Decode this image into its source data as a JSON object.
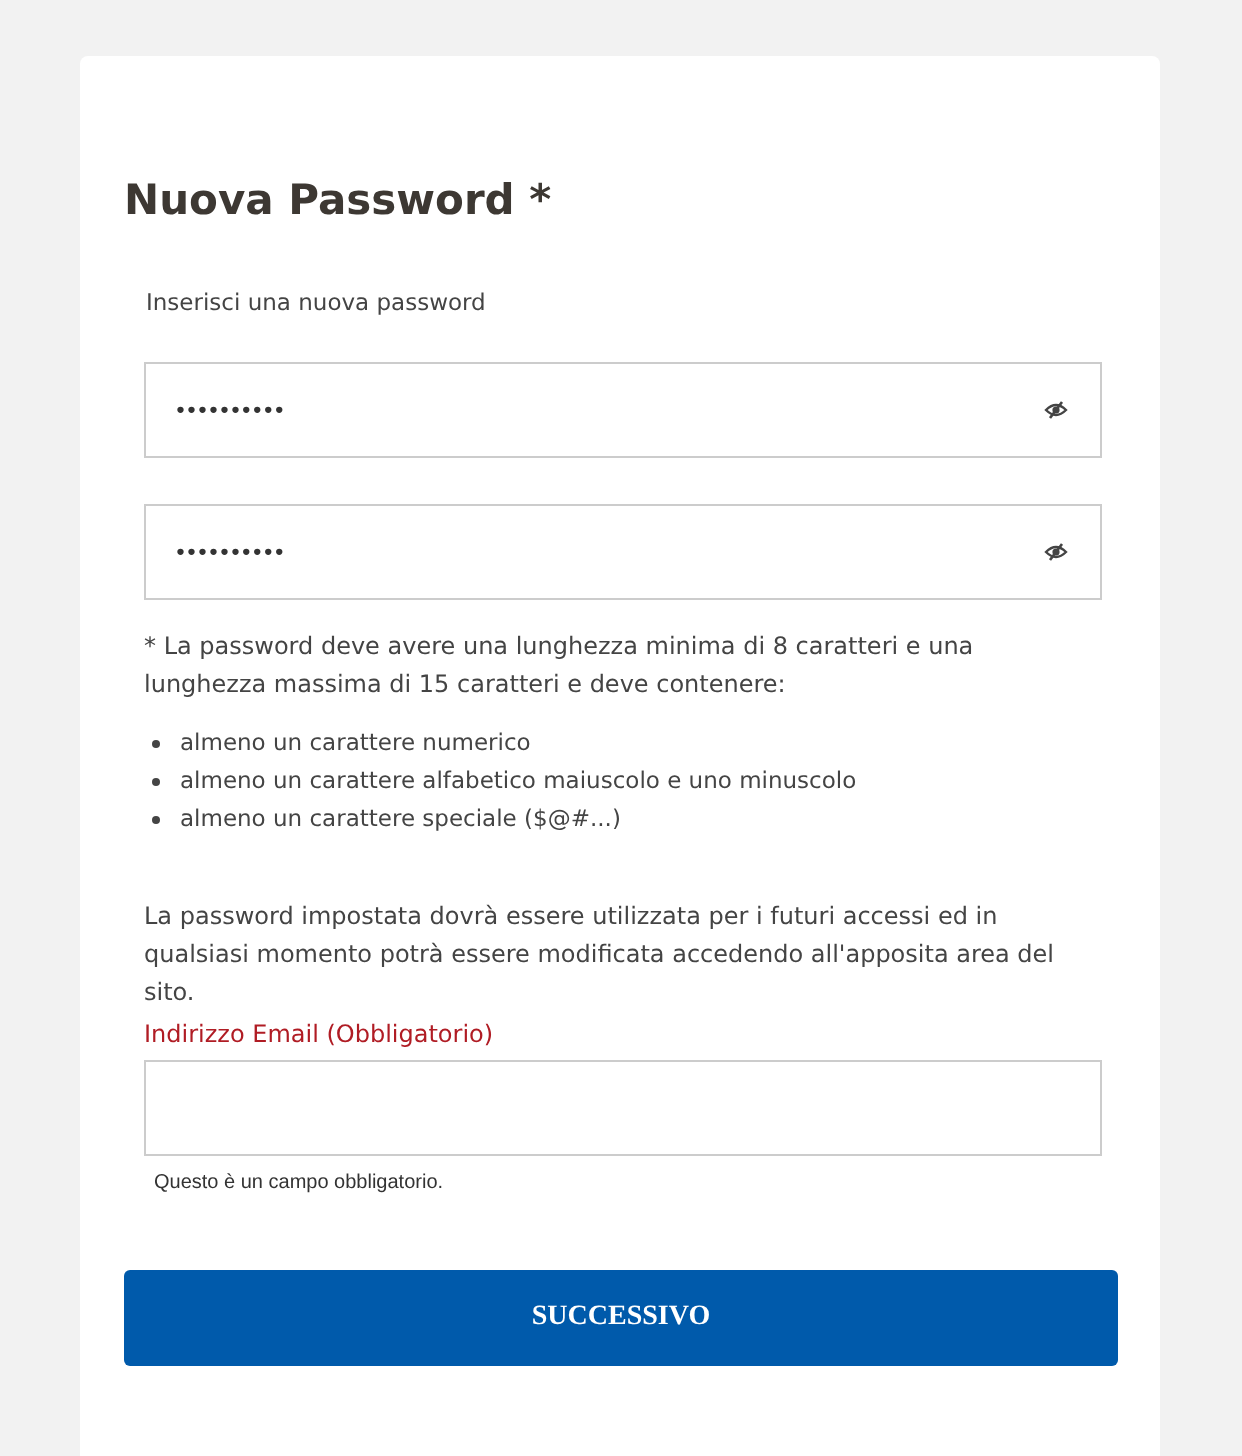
{
  "title": "Nuova Password *",
  "intro": "Inserisci una nuova password",
  "password_fields": [
    {
      "value": "••••••••••",
      "reveal": false
    },
    {
      "value": "••••••••••",
      "reveal": false
    }
  ],
  "rules_note": "*  La password deve avere una lunghezza minima di 8 caratteri e una lunghezza massima di 15 caratteri e deve contenere:",
  "rules": [
    "almeno un carattere numerico",
    "almeno un carattere alfabetico maiuscolo e uno minuscolo",
    "almeno un carattere speciale ($@#...)"
  ],
  "info": "La password impostata dovrà essere utilizzata per i futuri accessi ed in qualsiasi momento potrà essere modificata accedendo all'apposita area del sito.",
  "email": {
    "label": "Indirizzo Email (Obbligatorio)",
    "required": true,
    "hint": "Questo è un campo obbligatorio."
  },
  "button": "SUCCESSIVO"
}
